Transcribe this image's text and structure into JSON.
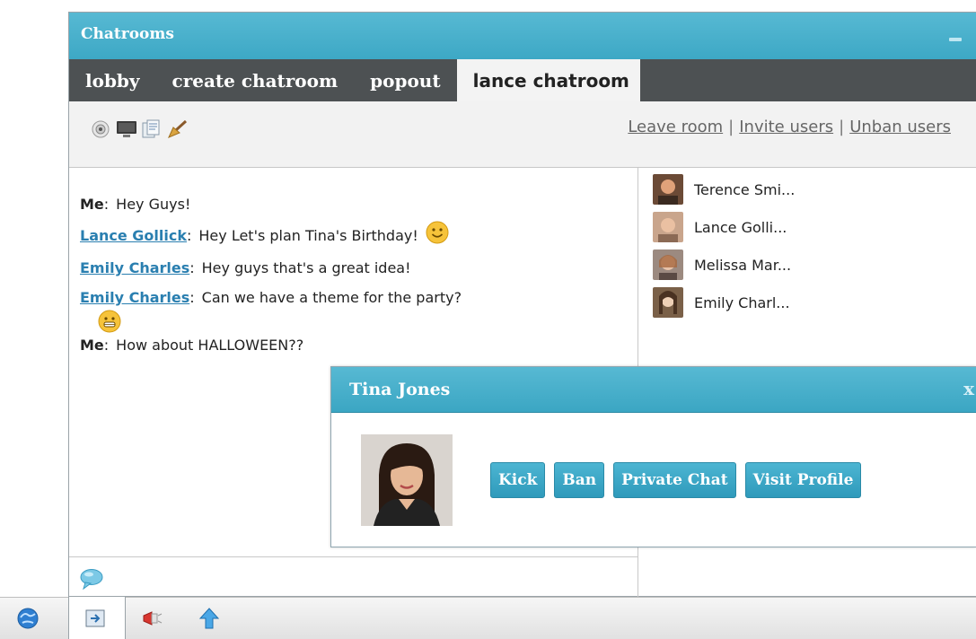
{
  "window": {
    "title": "Chatrooms",
    "tabs": [
      {
        "label": "lobby"
      },
      {
        "label": "create chatroom"
      },
      {
        "label": "popout"
      },
      {
        "label": "lance chatroom"
      }
    ],
    "toolbar": {
      "icons": [
        "webcam-icon",
        "screen-share-icon",
        "whiteboard-icon",
        "clear-broom-icon"
      ],
      "links": {
        "leave": "Leave room",
        "invite": "Invite users",
        "unban": "Unban users",
        "separator": "|"
      }
    },
    "messages": [
      {
        "sender": "Me",
        "text": "Hey Guys!"
      },
      {
        "sender": "Lance Gollick",
        "text": "Hey Let's plan Tina's Birthday!"
      },
      {
        "sender": "Emily Charles",
        "text": "Hey guys that's a great idea!"
      },
      {
        "sender": "Emily Charles",
        "text": "Can we have a theme for the party?"
      },
      {
        "sender": "Me",
        "text": "How about HALLOWEEN??"
      }
    ],
    "colon": ":",
    "users": [
      {
        "name": "Terence Smi..."
      },
      {
        "name": "Lance Golli..."
      },
      {
        "name": "Melissa Mar..."
      },
      {
        "name": "Emily Charl..."
      }
    ]
  },
  "popup": {
    "title": "Tina Jones",
    "close": "x",
    "buttons": {
      "kick": "Kick",
      "ban": "Ban",
      "private_chat": "Private Chat",
      "visit_profile": "Visit Profile"
    }
  },
  "colors": {
    "accent": "#3fa9c6",
    "tab_bar": "#4d5153",
    "link": "#2a7fb0"
  }
}
